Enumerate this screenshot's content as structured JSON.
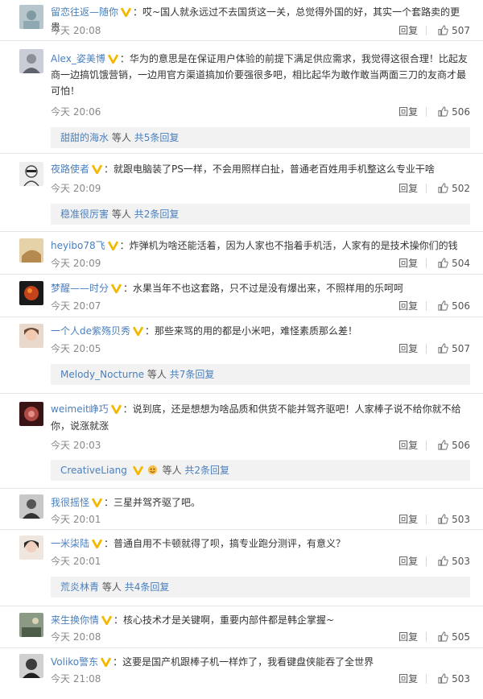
{
  "comments": [
    {
      "user": "留恋往返—随你",
      "text": "：哎~国人就永远过不去国货这一关，总觉得外国的好，其实一个套路卖的更贵",
      "time": "今天 20:08",
      "reply": "回复",
      "likes": "507",
      "avatar": "#b7c6cc"
    },
    {
      "user": "Alex_姿美博",
      "text": "：华为的意思是在保证用户体验的前提下满足供应需求，我觉得这很合理！比起友",
      "text2": "商一边搞饥饿营销，一边用官方渠道搞加价要强很多吧，相比起华为敢作敢当两面三刀的友商才最",
      "text3": "可怕！",
      "time": "今天 20:06",
      "reply": "回复",
      "likes": "506",
      "avatar": "#c9ced6",
      "sub": {
        "user": "甜甜的海水",
        "mid": "等人",
        "count": "共5条回复"
      }
    },
    {
      "user": "夜路使者",
      "text": "：就跟电脑装了PS一样，不会用照样白扯，普通老百姓用手机整这么专业干啥",
      "time": "今天 20:09",
      "reply": "回复",
      "likes": "502",
      "avatar": "#e3e3e3",
      "sub": {
        "user": "稳准很厉害",
        "mid": "等人",
        "count": "共2条回复"
      }
    },
    {
      "user": "heyibo78飞",
      "text": "：炸弹机为啥还能活着，因为人家也不指着手机活，人家有的是技术操你们的钱",
      "time": "今天 20:09",
      "reply": "回复",
      "likes": "504",
      "avatar": "#c9a76d"
    },
    {
      "user": "梦醒——时分",
      "text": "：水果当年不也这套路，只不过是没有爆出来，不照样用的乐呵呵",
      "time": "今天 20:07",
      "reply": "回复",
      "likes": "506",
      "avatar": "#a23b1e"
    },
    {
      "user": "一个人de紫殇贝秀",
      "text": "：那些来骂的用的都是小米吧，难怪素质那么差！",
      "time": "今天 20:05",
      "reply": "回复",
      "likes": "507",
      "avatar": "#d9b9a8",
      "sub": {
        "user": "Melody_Nocturne",
        "mid": "等人",
        "count": "共7条回复"
      }
    },
    {
      "user": "weimeit峥巧",
      "text": "：说到底，还是想想为啥品质和供货不能并驾齐驱吧！人家棒子说不给你就不给",
      "text2": "你，说涨就涨",
      "time": "今天 20:03",
      "reply": "回复",
      "likes": "506",
      "avatar": "#b04a45",
      "sub": {
        "user": "CreativeLiang",
        "mid": "等人",
        "count": "共2条回复"
      }
    },
    {
      "user": "我很摇怪",
      "text": "：三星并驾齐驱了吧。",
      "time": "今天 20:01",
      "reply": "回复",
      "likes": "503",
      "avatar": "#777777"
    },
    {
      "user": "一米柒陆",
      "text": "：普通自用不卡顿就得了呗，搞专业跑分测评，有意义？",
      "time": "今天 20:01",
      "reply": "回复",
      "likes": "503",
      "avatar": "#d2b7ad",
      "sub": {
        "user": "荒炎林青",
        "mid": "等人",
        "count": "共4条回复"
      }
    },
    {
      "user": "来生换你情",
      "text": "：核心技术才是关键啊，重要内部件都是韩企掌握~",
      "time": "今天 20:08",
      "reply": "回复",
      "likes": "505",
      "avatar": "#6d7f6a"
    },
    {
      "user": "Voliko警东",
      "text": "：这要是国产机跟棒子机一样炸了，我看键盘侠能吞了全世界",
      "time": "今天 21:08",
      "reply": "回复",
      "likes": "503",
      "avatar": "#5b5b5b"
    }
  ],
  "colors": {
    "link": "#4a7fbd",
    "badge": "#f5b800"
  }
}
